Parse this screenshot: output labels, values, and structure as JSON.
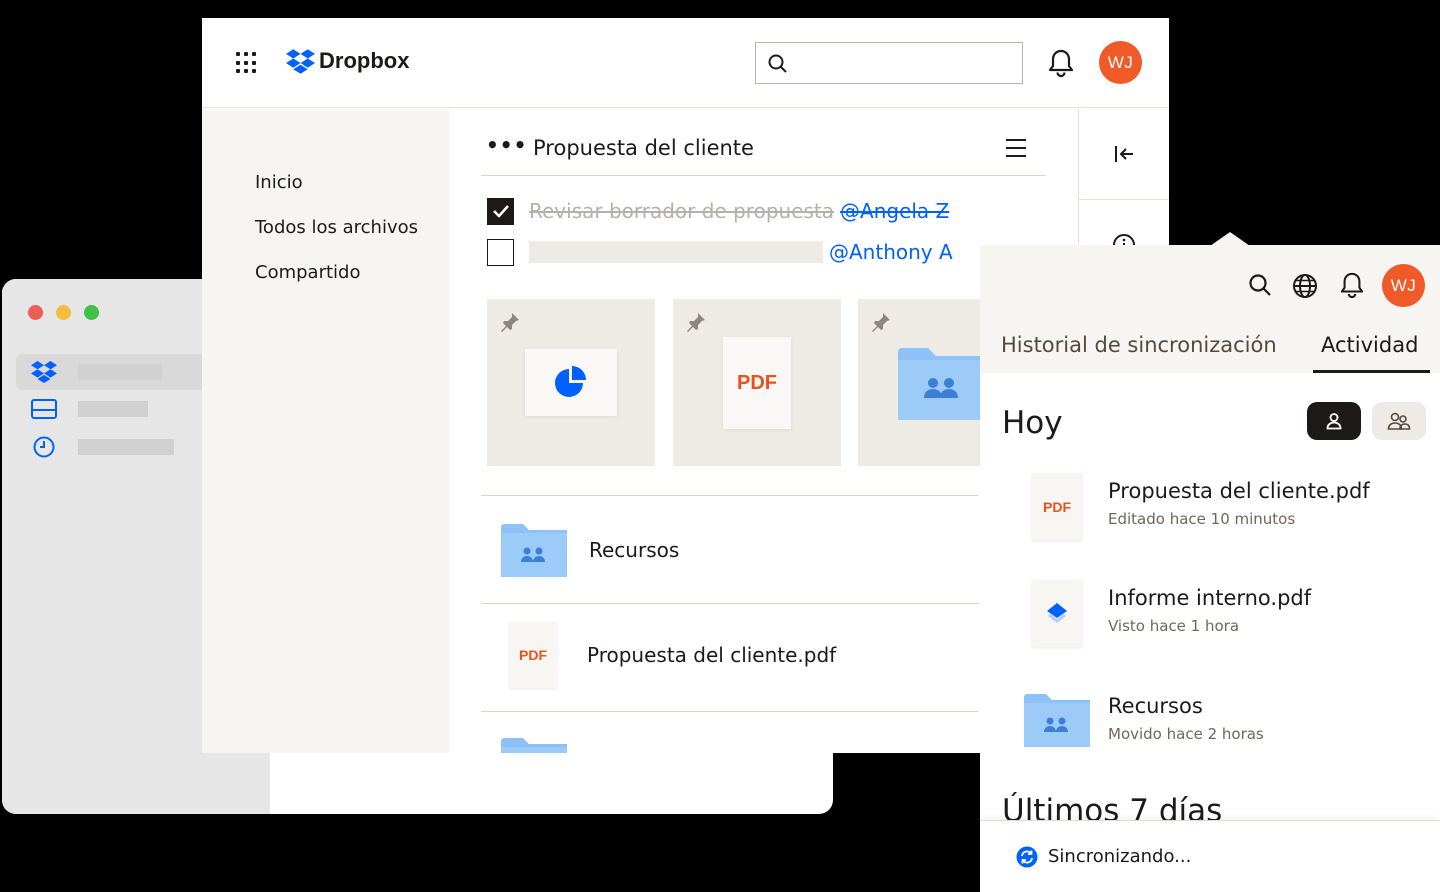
{
  "app": {
    "brand": "Dropbox",
    "avatar_initials": "WJ",
    "accent": "#0061fe",
    "avatar_color": "#f05a28"
  },
  "search": {
    "placeholder": ""
  },
  "leftnav": {
    "items": [
      "Inicio",
      "Todos los archivos",
      "Compartido"
    ]
  },
  "doc": {
    "title": "Propuesta del cliente",
    "tasks": [
      {
        "text": "Revisar borrador de propuesta",
        "mention": "@Angela Z",
        "checked": true
      },
      {
        "text": "",
        "mention": "@Anthony A",
        "checked": false
      }
    ],
    "tiles": [
      {
        "type": "chart",
        "icon": "pie-chart-icon"
      },
      {
        "type": "pdf",
        "label": "PDF"
      },
      {
        "type": "folder",
        "icon": "shared-folder-icon"
      }
    ],
    "files": [
      {
        "name": "Recursos",
        "type": "folder"
      },
      {
        "name": "Propuesta del cliente.pdf",
        "type": "pdf",
        "badge": "PDF"
      }
    ]
  },
  "panel": {
    "tabs": [
      "Historial de sincronización",
      "Actividad"
    ],
    "active_tab": "Actividad",
    "section_today": "Hoy",
    "items": [
      {
        "name": "Propuesta del cliente.pdf",
        "sub": "Editado hace 10 minutos",
        "type": "pdf",
        "badge": "PDF"
      },
      {
        "name": "Informe interno.pdf",
        "sub": "Visto hace 1 hora",
        "type": "dropbox-doc"
      },
      {
        "name": "Recursos",
        "sub": "Movido hace 2 horas",
        "type": "folder"
      }
    ],
    "section_week": "Últimos 7 días",
    "sync_status": "Sincronizando..."
  }
}
